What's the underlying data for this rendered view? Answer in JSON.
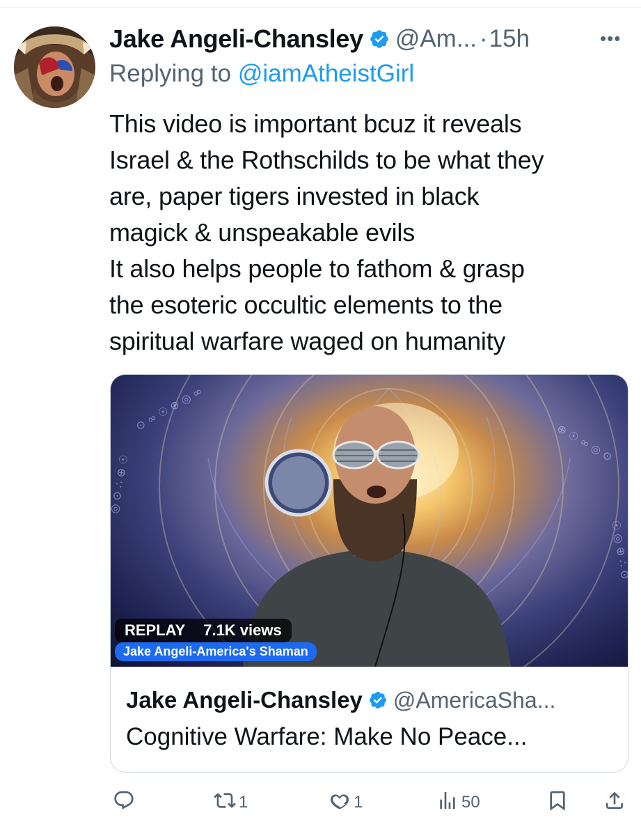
{
  "tweet": {
    "author_name": "Jake Angeli-Chansley",
    "handle": "@Am...",
    "separator": "·",
    "time": "15h",
    "more_label": "•••",
    "replying_prefix": "Replying to ",
    "replying_to": "@iamAtheistGirl",
    "text_lines": [
      "This video is important bcuz it reveals",
      "Israel & the Rothschilds to be what they",
      "are, paper tigers invested in black",
      "magick & unspeakable evils",
      "It also helps people to fathom & grasp",
      "the esoteric occultic elements to the",
      "spiritual warfare waged on humanity"
    ]
  },
  "card": {
    "replay_label": "REPLAY",
    "views": "7.1K views",
    "channel_tag": "Jake Angeli-America's Shaman",
    "author_name": "Jake Angeli-Chansley",
    "handle": "@AmericaSha...",
    "title": "Cognitive Warfare: Make No Peace..."
  },
  "actions": {
    "reply": {
      "icon": "reply-icon",
      "count": ""
    },
    "retweet": {
      "icon": "retweet-icon",
      "count": "1"
    },
    "like": {
      "icon": "heart-icon",
      "count": "1"
    },
    "views": {
      "icon": "views-icon",
      "count": "50"
    },
    "bookmark": {
      "icon": "bookmark-icon"
    },
    "share": {
      "icon": "share-icon"
    }
  },
  "colors": {
    "text": "#0f1419",
    "secondary": "#536471",
    "accent": "#1d9bf0",
    "border": "#cfd9de"
  }
}
